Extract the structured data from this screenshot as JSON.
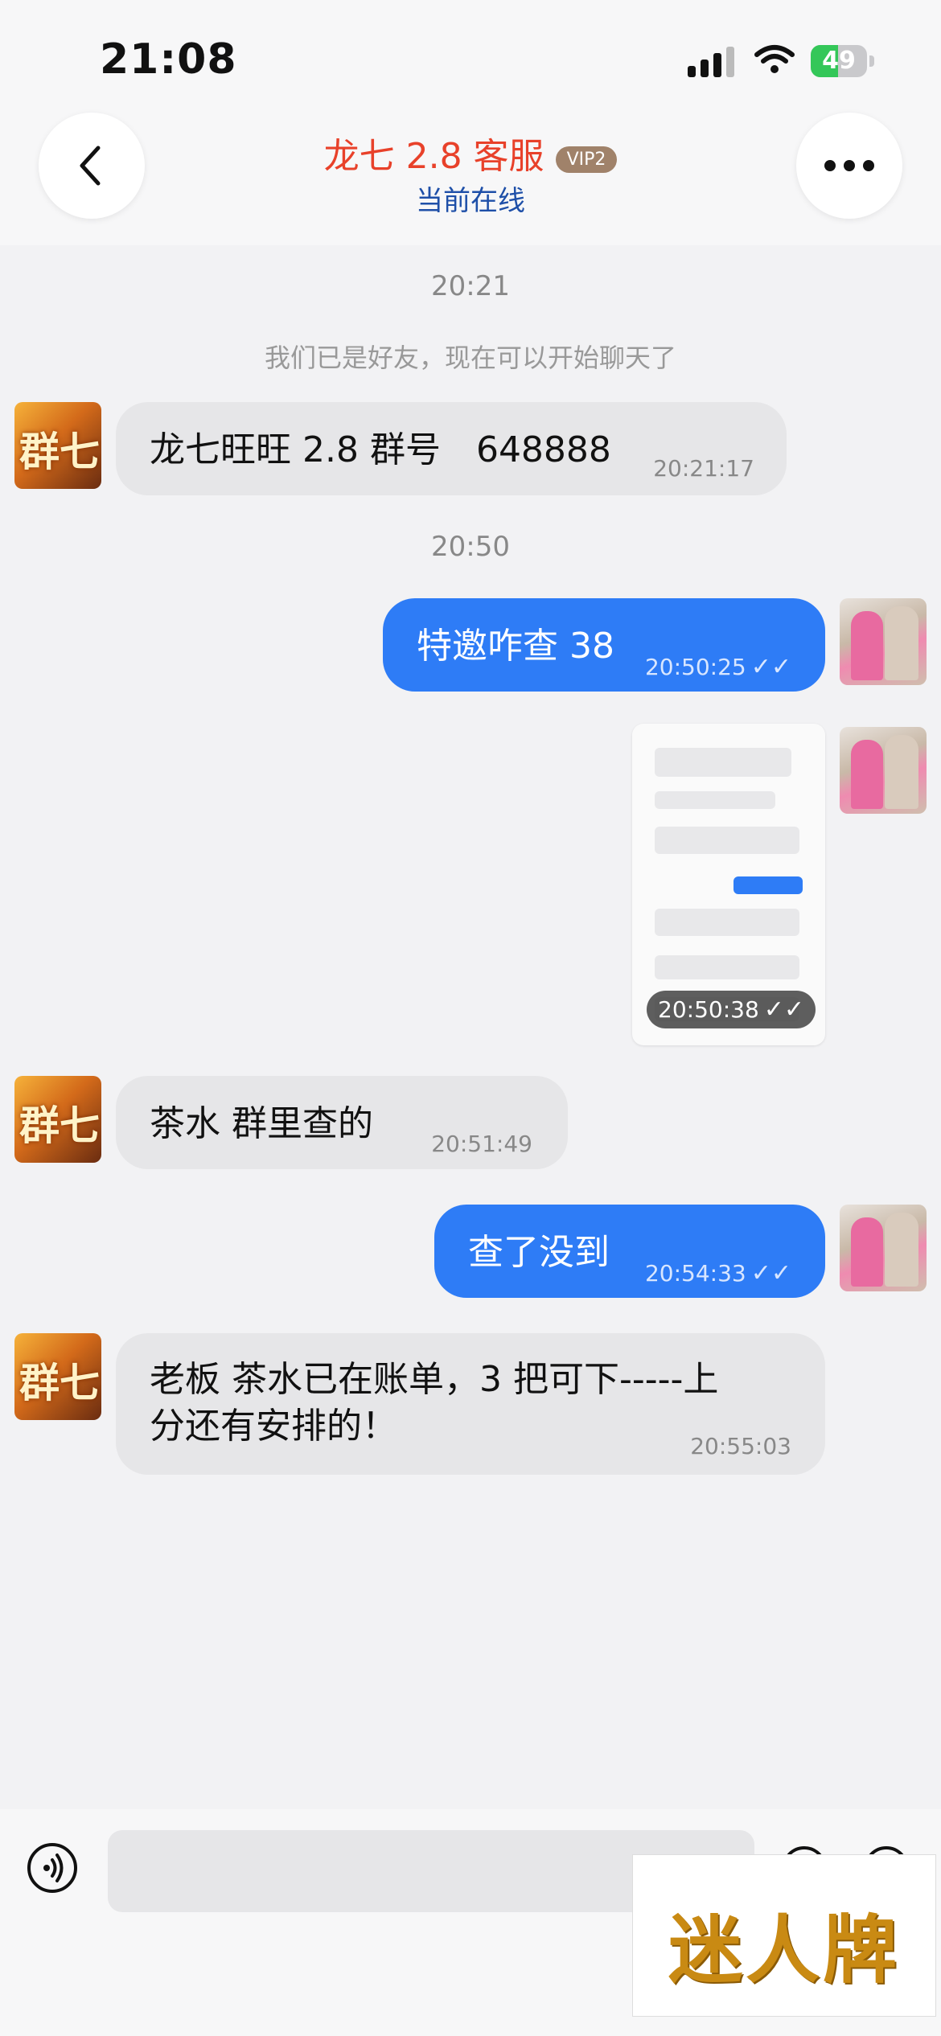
{
  "status_bar": {
    "time": "21:08",
    "battery": "49",
    "battery_level": 0.49
  },
  "header": {
    "title": "龙七 2.8 客服",
    "badge": "VIP2",
    "subtitle": "当前在线"
  },
  "chat": {
    "timestamp_1": "20:21",
    "system_note": "我们已是好友，现在可以开始聊天了",
    "msg_1": {
      "text": "龙七旺旺 2.8 群号　648888",
      "time": "20:21:17"
    },
    "timestamp_2": "20:50",
    "msg_2": {
      "text": "特邀咋查 38",
      "time": "20:50:25"
    },
    "msg_3_image": {
      "time": "20:50:38"
    },
    "msg_4": {
      "text": "茶水  群里查的",
      "time": "20:51:49"
    },
    "msg_5": {
      "text": "查了没到",
      "time": "20:54:33"
    },
    "msg_6": {
      "line1": "老板 茶水已在账单，3 把可下-----上",
      "line2": "分还有安排的！",
      "time": "20:55:03"
    }
  },
  "input_bar": {
    "placeholder": ""
  },
  "watermark": {
    "text": "迷人牌"
  },
  "colors": {
    "accent_blue": "#2e7cf6",
    "title_red": "#e8412a",
    "subtitle_blue": "#1e4fa8"
  }
}
